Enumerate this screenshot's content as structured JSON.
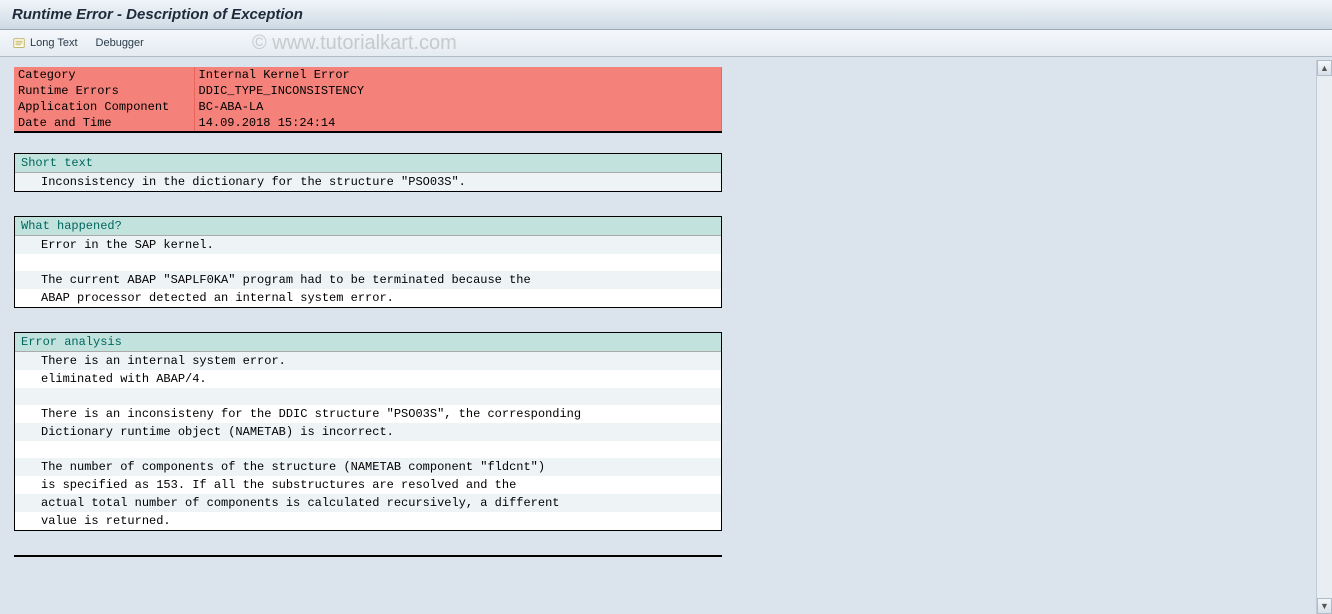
{
  "title": "Runtime Error - Description of Exception",
  "toolbar": {
    "long_text": "Long Text",
    "debugger": "Debugger"
  },
  "info": {
    "category_label": "Category",
    "category_value": "Internal Kernel Error",
    "runtime_label": "Runtime Errors",
    "runtime_value": "DDIC_TYPE_INCONSISTENCY",
    "appcomp_label": "Application Component",
    "appcomp_value": "BC-ABA-LA",
    "datetime_label": "Date and Time",
    "datetime_value": "14.09.2018 15:24:14"
  },
  "sections": {
    "short_text": {
      "header": "Short text",
      "lines": [
        "Inconsistency in the dictionary for the structure \"PSO03S\"."
      ]
    },
    "what_happened": {
      "header": "What happened?",
      "lines": [
        "Error in the SAP kernel.",
        "",
        "The current ABAP \"SAPLF0KA\" program had to be terminated because the",
        "ABAP processor detected an internal system error."
      ]
    },
    "error_analysis": {
      "header": "Error analysis",
      "lines": [
        "There is an internal system error.",
        "eliminated with ABAP/4.",
        "",
        "There is an inconsisteny for the DDIC structure \"PSO03S\", the corresponding",
        "Dictionary runtime object (NAMETAB) is incorrect.",
        "",
        "The number of components of the structure (NAMETAB component \"fldcnt\")",
        "is specified as 153. If all the substructures are resolved and the",
        "actual total number of components is calculated recursively, a different",
        "value is returned."
      ]
    }
  },
  "watermark": "© www.tutorialkart.com"
}
